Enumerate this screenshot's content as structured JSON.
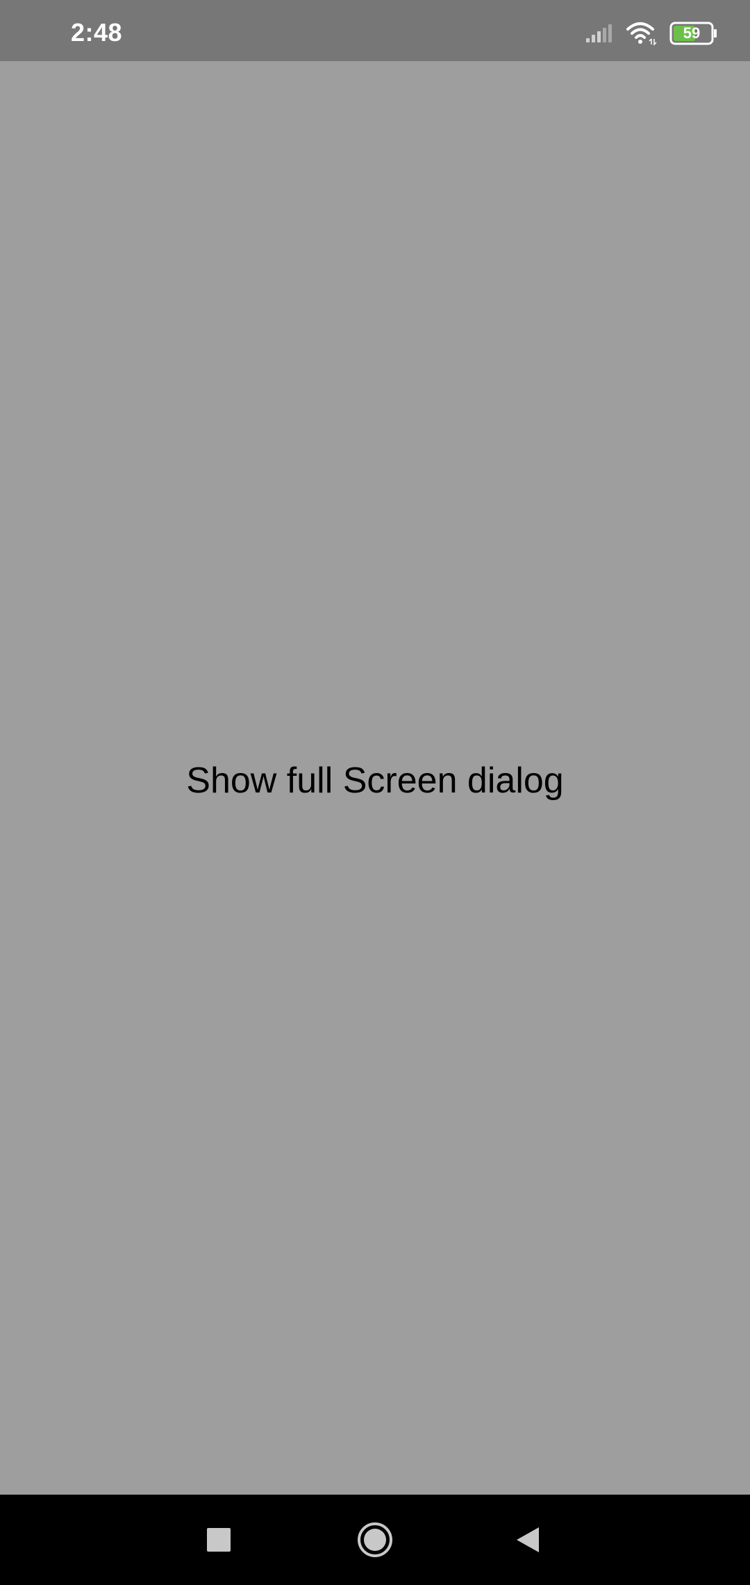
{
  "status_bar": {
    "time": "2:48",
    "battery_level": "59",
    "battery_color": "#6cc04a",
    "icons": [
      "signal-icon",
      "wifi-icon",
      "battery-icon"
    ]
  },
  "main": {
    "button_label": "Show full Screen dialog"
  },
  "nav_bar": {
    "buttons": [
      "recents-icon",
      "home-icon",
      "back-icon"
    ]
  },
  "colors": {
    "background": "#9e9e9e",
    "status_bar": "#777777",
    "nav_bar": "#000000"
  }
}
